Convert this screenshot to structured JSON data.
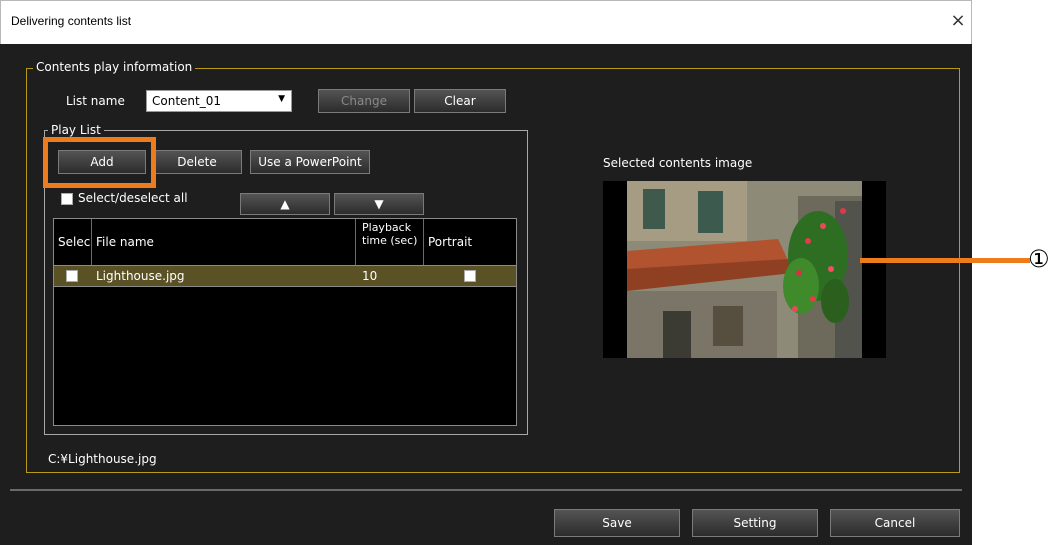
{
  "window": {
    "title": "Delivering contents list",
    "close_symbol": "×"
  },
  "contents_play_info": {
    "legend": "Contents play information",
    "list_name_label": "List name",
    "list_name_value": "Content_01",
    "change_button": "Change",
    "clear_button": "Clear"
  },
  "play_list": {
    "legend": "Play List",
    "add_button": "Add",
    "delete_button": "Delete",
    "powerpoint_button": "Use a PowerPoint",
    "select_all_label": "Select/deselect all",
    "up_symbol": "▲",
    "down_symbol": "▼",
    "columns": [
      "Selec",
      "File name",
      "Playback time (sec)",
      "Portrait"
    ],
    "rows": [
      {
        "selected": false,
        "file_name": "Lighthouse.jpg",
        "playback_time": "10",
        "portrait": false
      }
    ]
  },
  "file_path": "C:¥Lighthouse.jpg",
  "preview": {
    "label": "Selected contents image"
  },
  "footer": {
    "save_button": "Save",
    "setting_button": "Setting",
    "cancel_button": "Cancel"
  },
  "callout": {
    "number": "①"
  },
  "colors": {
    "highlight": "#ee7b1c",
    "group_border": "#b89a1a",
    "selected_row": "#5a5225"
  }
}
